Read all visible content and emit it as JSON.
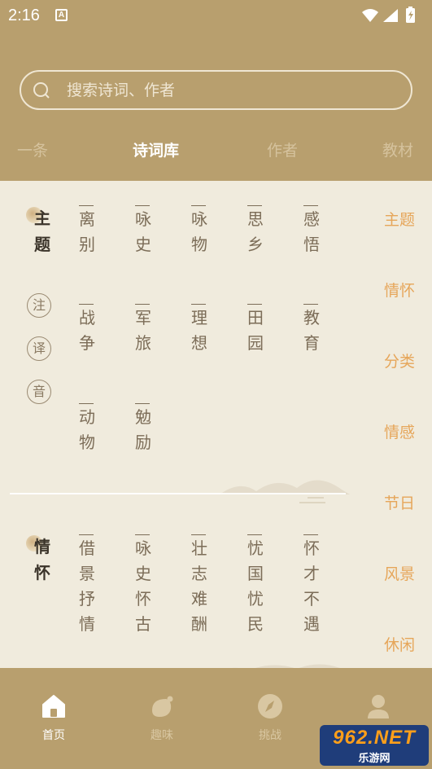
{
  "status_bar": {
    "time": "2:16",
    "notification_badge": "A"
  },
  "search": {
    "placeholder": "搜索诗词、作者"
  },
  "tabs": [
    {
      "label": "一条"
    },
    {
      "label": "诗词库",
      "active": true
    },
    {
      "label": "作者"
    },
    {
      "label": "教材"
    }
  ],
  "side_badges": [
    "注",
    "译",
    "音"
  ],
  "categories": [
    {
      "title_chars": [
        "主",
        "题"
      ],
      "rows": [
        [
          {
            "chars": [
              "离",
              "别"
            ]
          },
          {
            "chars": [
              "咏",
              "史"
            ]
          },
          {
            "chars": [
              "咏",
              "物"
            ]
          },
          {
            "chars": [
              "思",
              "乡"
            ]
          },
          {
            "chars": [
              "感",
              "悟"
            ]
          }
        ],
        [
          {
            "chars": [
              "战",
              "争"
            ]
          },
          {
            "chars": [
              "军",
              "旅"
            ]
          },
          {
            "chars": [
              "理",
              "想"
            ]
          },
          {
            "chars": [
              "田",
              "园"
            ]
          },
          {
            "chars": [
              "教",
              "育"
            ]
          }
        ],
        [
          {
            "chars": [
              "动",
              "物"
            ]
          },
          {
            "chars": [
              "勉",
              "励"
            ]
          }
        ]
      ]
    },
    {
      "title_chars": [
        "情",
        "怀"
      ],
      "rows": [
        [
          {
            "chars": [
              "借",
              "景",
              "抒",
              "情"
            ]
          },
          {
            "chars": [
              "咏",
              "史",
              "怀",
              "古"
            ]
          },
          {
            "chars": [
              "壮",
              "志",
              "难",
              "酬"
            ]
          },
          {
            "chars": [
              "忧",
              "国",
              "忧",
              "民"
            ]
          },
          {
            "chars": [
              "怀",
              "才",
              "不",
              "遇"
            ]
          }
        ]
      ]
    }
  ],
  "side_nav": [
    "主题",
    "情怀",
    "分类",
    "情感",
    "节日",
    "风景",
    "休闲"
  ],
  "bottom_nav": [
    {
      "label": "首页",
      "icon": "home-icon",
      "active": true
    },
    {
      "label": "趣味",
      "icon": "fun-icon"
    },
    {
      "label": "挑战",
      "icon": "compass-icon"
    },
    {
      "label": "",
      "icon": "profile-icon"
    }
  ],
  "watermark": {
    "top": "962.NET",
    "bottom": "乐游网"
  },
  "colors": {
    "header": "#b89f6e",
    "content_bg": "#f0ebdd",
    "side_nav_text": "#e6a65a",
    "word_text": "#7c6d58"
  }
}
